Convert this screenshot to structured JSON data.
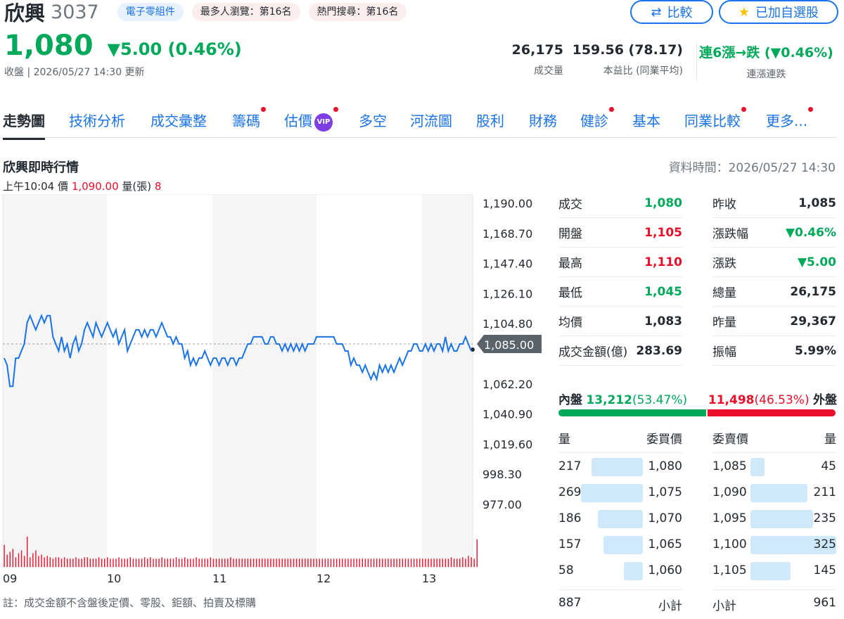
{
  "header": {
    "name": "欣興",
    "code": "3037",
    "tags": [
      "電子零組件",
      "最多人瀏覽：第16名",
      "熱門搜尋：第16名"
    ],
    "compare_label": "比較",
    "watch_label": "已加自選股",
    "price": "1,080",
    "change": "▼5.00 (0.46%)",
    "subline": "收盤 | 2026/05/27 14:30 更新",
    "kpis": [
      {
        "value": "26,175",
        "label": "成交量"
      },
      {
        "value": "159.56 (78.17)",
        "label": "本益比 (同業平均)"
      },
      {
        "value": "連6漲→跌 (▼0.46%)",
        "label": "連漲連跌"
      }
    ],
    "accent_color": "#1a73e8",
    "down_color": "#00a85a",
    "up_color": "#eb0f29"
  },
  "nav": {
    "items": [
      {
        "label": "走勢圖",
        "active": true,
        "dot": false
      },
      {
        "label": "技術分析",
        "dot": false
      },
      {
        "label": "成交彙整",
        "dot": false
      },
      {
        "label": "籌碼",
        "dot": true
      },
      {
        "label": "估價",
        "dot": true,
        "vip": "VIP"
      },
      {
        "label": "多空",
        "dot": false
      },
      {
        "label": "河流圖",
        "dot": false
      },
      {
        "label": "股利",
        "dot": false
      },
      {
        "label": "財務",
        "dot": false
      },
      {
        "label": "健診",
        "dot": true
      },
      {
        "label": "基本",
        "dot": false
      },
      {
        "label": "同業比較",
        "dot": true
      },
      {
        "label": "更多...",
        "dot": true
      }
    ]
  },
  "section": {
    "title": "欣興即時行情",
    "data_time": "資料時間：2026/05/27 14:30",
    "hover": {
      "time": "上午10:04",
      "price_label": "價",
      "price": "1,090.00",
      "vol_label": "量(張)",
      "vol": "8"
    },
    "note": "註：成交金額不含盤後定價、零股、鉅額、拍賣及標購"
  },
  "chart_data": {
    "type": "line",
    "y_ticks": [
      "1,190.00",
      "1,168.70",
      "1,147.40",
      "1,126.10",
      "1,104.80",
      "1,062.20",
      "1,040.90",
      "1,019.60",
      "998.30",
      "977.00"
    ],
    "ylim": [
      977,
      1190
    ],
    "reference": 1085,
    "reference_label": "1,085.00",
    "x_ticks": [
      "09",
      "10",
      "11",
      "12",
      "13"
    ],
    "line_color": "#1a73e8",
    "volume_color": "#eb0f29",
    "price_series": [
      1075,
      1070,
      1055,
      1055,
      1075,
      1075,
      1080,
      1085,
      1100,
      1105,
      1100,
      1095,
      1100,
      1105,
      1100,
      1105,
      1105,
      1090,
      1085,
      1080,
      1090,
      1080,
      1085,
      1075,
      1085,
      1090,
      1080,
      1085,
      1095,
      1100,
      1095,
      1090,
      1100,
      1095,
      1090,
      1095,
      1100,
      1095,
      1090,
      1095,
      1085,
      1090,
      1095,
      1080,
      1085,
      1090,
      1095,
      1095,
      1090,
      1095,
      1090,
      1095,
      1095,
      1090,
      1095,
      1100,
      1095,
      1090,
      1090,
      1085,
      1090,
      1085,
      1085,
      1075,
      1080,
      1070,
      1075,
      1070,
      1075,
      1075,
      1080,
      1075,
      1070,
      1075,
      1075,
      1070,
      1075,
      1075,
      1070,
      1075,
      1075,
      1070,
      1075,
      1075,
      1080,
      1085,
      1085,
      1090,
      1090,
      1090,
      1090,
      1085,
      1085,
      1090,
      1090,
      1085,
      1085,
      1080,
      1085,
      1080,
      1085,
      1080,
      1085,
      1080,
      1085,
      1080,
      1085,
      1085,
      1085,
      1090,
      1090,
      1090,
      1090,
      1090,
      1090,
      1090,
      1085,
      1085,
      1085,
      1080,
      1080,
      1070,
      1075,
      1070,
      1070,
      1065,
      1070,
      1065,
      1060,
      1065,
      1060,
      1070,
      1065,
      1070,
      1065,
      1070,
      1065,
      1070,
      1075,
      1070,
      1075,
      1080,
      1080,
      1085,
      1085,
      1080,
      1080,
      1085,
      1080,
      1085,
      1080,
      1085,
      1085,
      1080,
      1090,
      1080,
      1085,
      1080,
      1080,
      1085,
      1085,
      1090,
      1085,
      1080
    ],
    "volume_series": [
      32,
      18,
      22,
      26,
      14,
      20,
      24,
      16,
      44,
      14,
      20,
      24,
      16,
      18,
      14,
      16,
      14,
      12,
      14,
      14,
      12,
      14,
      12,
      12,
      12,
      14,
      12,
      12,
      14,
      14,
      12,
      12,
      12,
      14,
      12,
      12,
      14,
      12,
      12,
      12,
      14,
      12,
      12,
      12,
      14,
      12,
      12,
      12,
      12,
      14,
      12,
      14,
      12,
      12,
      12,
      14,
      12,
      12,
      12,
      12,
      14,
      12,
      12,
      14,
      12,
      12,
      12,
      14,
      12,
      12,
      12,
      12,
      14,
      12,
      12,
      12,
      12,
      12,
      12,
      14,
      12,
      12,
      12,
      12,
      12,
      12,
      12,
      12,
      12,
      12,
      12,
      12,
      12,
      12,
      12,
      12,
      12,
      12,
      12,
      12,
      12,
      12,
      12,
      12,
      12,
      12,
      12,
      12,
      12,
      12,
      12,
      12,
      12,
      12,
      12,
      12,
      12,
      12,
      12,
      12,
      12,
      12,
      12,
      12,
      12,
      12,
      12,
      12,
      12,
      12,
      12,
      12,
      12,
      12,
      12,
      12,
      12,
      12,
      12,
      12,
      12,
      12,
      12,
      12,
      12,
      12,
      12,
      12,
      12,
      12,
      12,
      12,
      12,
      12,
      12,
      12,
      14,
      12,
      12,
      12,
      14,
      12,
      16,
      14,
      12,
      40
    ]
  },
  "quote": {
    "left": [
      {
        "label": "成交",
        "value": "1,080",
        "color": "g"
      },
      {
        "label": "開盤",
        "value": "1,105",
        "color": "r"
      },
      {
        "label": "最高",
        "value": "1,110",
        "color": "r"
      },
      {
        "label": "最低",
        "value": "1,045",
        "color": "g"
      },
      {
        "label": "均價",
        "value": "1,083",
        "color": ""
      },
      {
        "label": "成交金額(億)",
        "value": "283.69",
        "color": ""
      }
    ],
    "right": [
      {
        "label": "昨收",
        "value": "1,085",
        "color": ""
      },
      {
        "label": "漲跌幅",
        "value": "▼0.46%",
        "color": "g"
      },
      {
        "label": "漲跌",
        "value": "▼5.00",
        "color": "g"
      },
      {
        "label": "總量",
        "value": "26,175",
        "color": ""
      },
      {
        "label": "昨量",
        "value": "29,367",
        "color": ""
      },
      {
        "label": "振幅",
        "value": "5.99%",
        "color": ""
      }
    ],
    "inner_label": "內盤",
    "inner_value": "13,212",
    "inner_pct": "(53.47%)",
    "inner_fraction": 0.5347,
    "outer_label": "外盤",
    "outer_value": "11,498",
    "outer_pct": "(46.53%)"
  },
  "orderbook": {
    "bid_headers": [
      "量",
      "委買價"
    ],
    "ask_headers": [
      "委賣價",
      "量"
    ],
    "bids": [
      {
        "qty": "217",
        "price": "1,080",
        "q": 217
      },
      {
        "qty": "269",
        "price": "1,075",
        "q": 269
      },
      {
        "qty": "186",
        "price": "1,070",
        "q": 186
      },
      {
        "qty": "157",
        "price": "1,065",
        "q": 157
      },
      {
        "qty": "58",
        "price": "1,060",
        "q": 58
      }
    ],
    "asks": [
      {
        "price": "1,085",
        "qty": "45",
        "q": 45
      },
      {
        "price": "1,090",
        "qty": "211",
        "q": 211
      },
      {
        "price": "1,095",
        "qty": "235",
        "q": 235
      },
      {
        "price": "1,100",
        "qty": "325",
        "q": 325
      },
      {
        "price": "1,105",
        "qty": "145",
        "q": 145
      }
    ],
    "bid_total": "887",
    "subtotal_label": "小計",
    "ask_total": "961"
  }
}
